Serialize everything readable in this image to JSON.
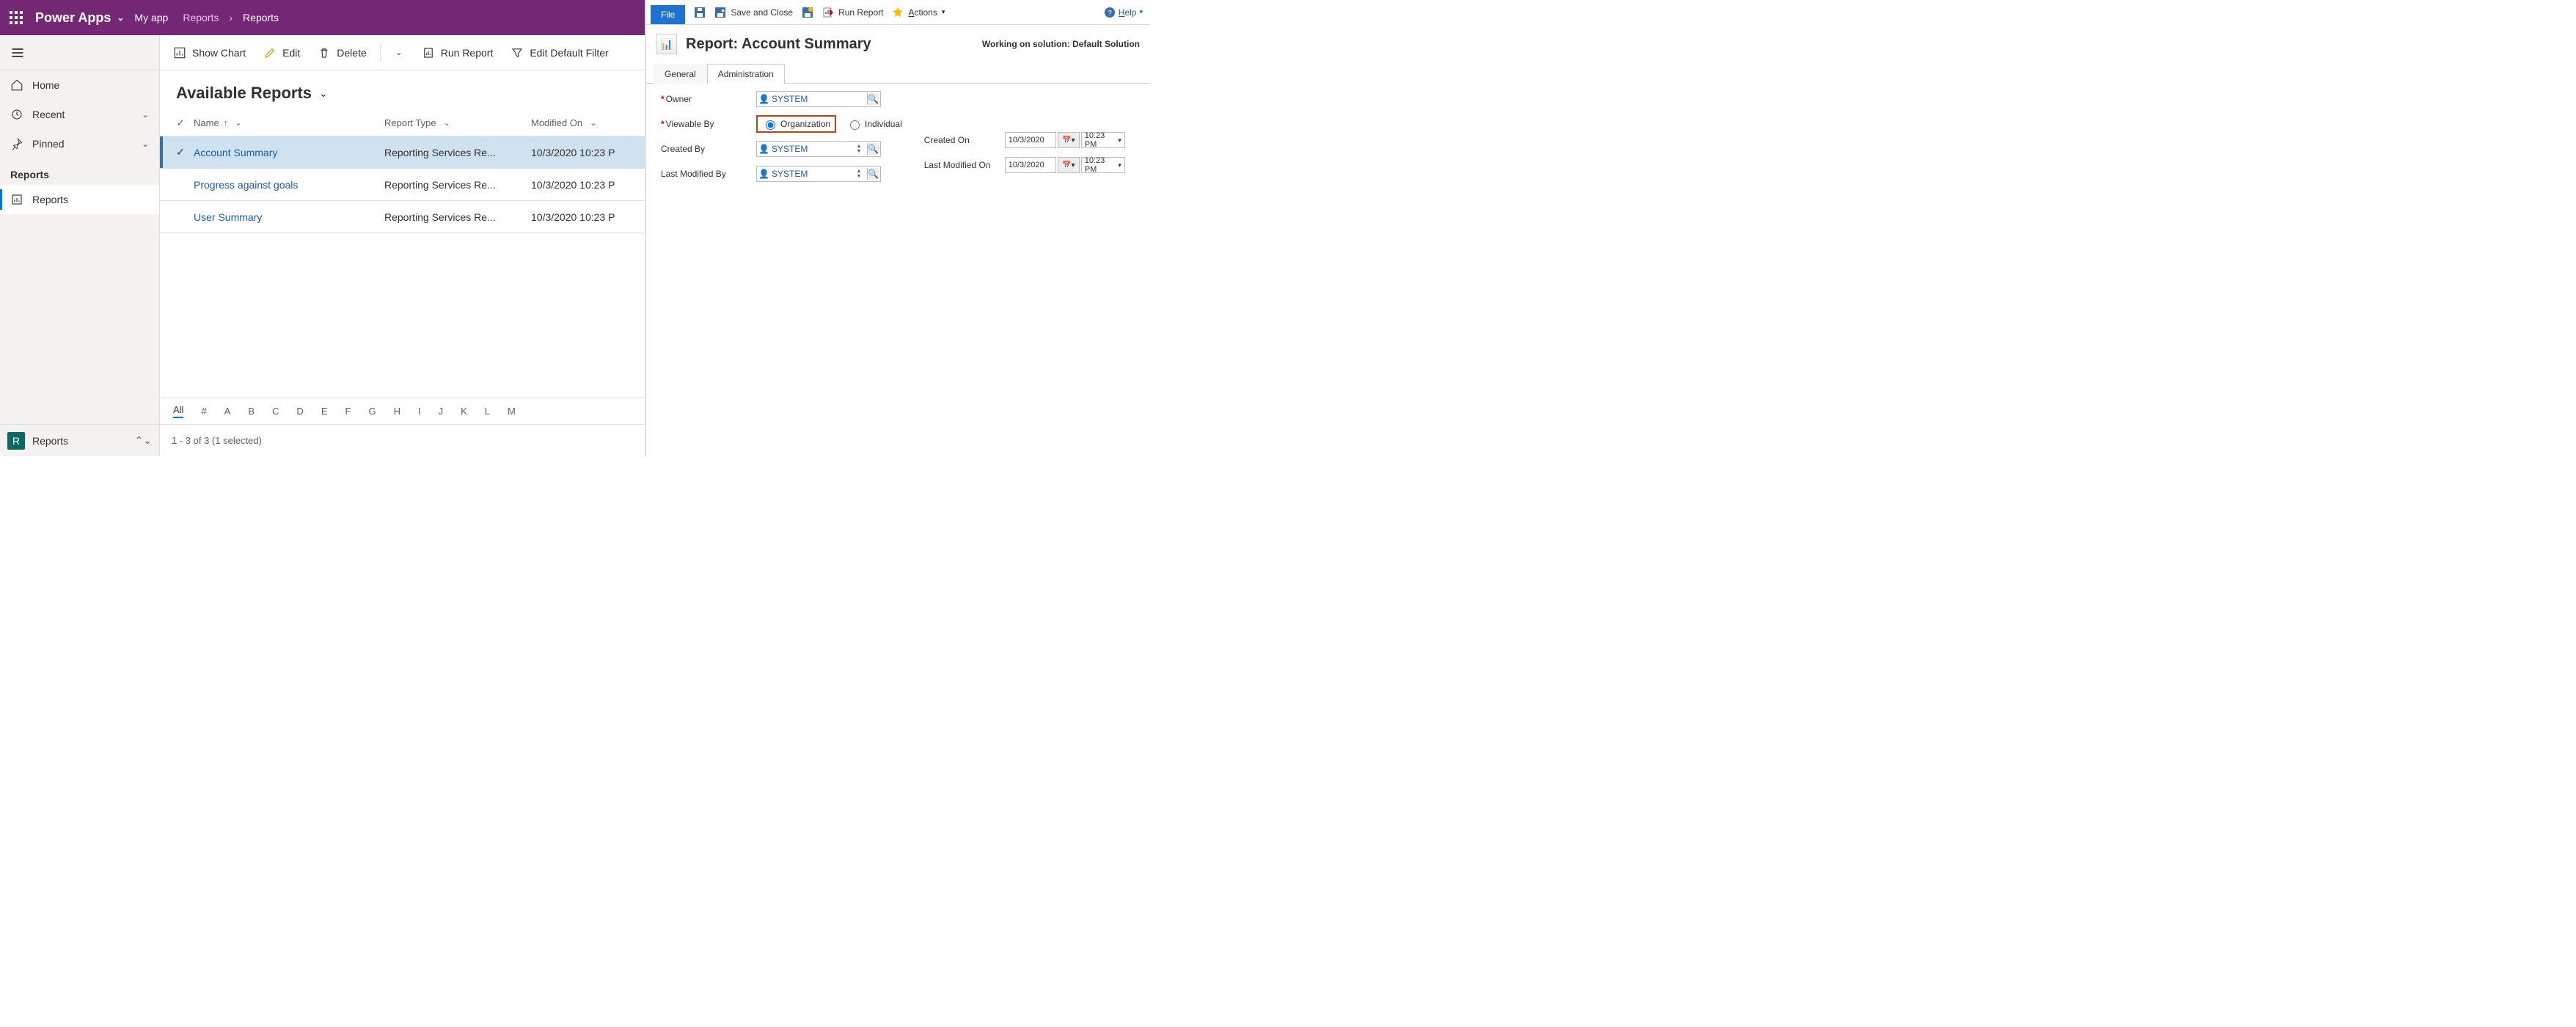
{
  "topbar": {
    "app": "Power Apps",
    "myapp": "My app",
    "crumb1": "Reports",
    "crumb_sep": "›",
    "crumb2": "Reports"
  },
  "sidebar": {
    "home": "Home",
    "recent": "Recent",
    "pinned": "Pinned",
    "section": "Reports",
    "reports": "Reports",
    "footer_badge": "R",
    "footer_label": "Reports"
  },
  "toolbar": {
    "show_chart": "Show Chart",
    "edit": "Edit",
    "delete": "Delete",
    "run_report": "Run Report",
    "edit_filter": "Edit Default Filter"
  },
  "list": {
    "title": "Available Reports",
    "cols": {
      "name": "Name",
      "type": "Report Type",
      "modified": "Modified On"
    },
    "rows": [
      {
        "name": "Account Summary",
        "type": "Reporting Services Re...",
        "modified": "10/3/2020 10:23 P",
        "selected": true
      },
      {
        "name": "Progress against goals",
        "type": "Reporting Services Re...",
        "modified": "10/3/2020 10:23 P",
        "selected": false
      },
      {
        "name": "User Summary",
        "type": "Reporting Services Re...",
        "modified": "10/3/2020 10:23 P",
        "selected": false
      }
    ],
    "alpha": [
      "All",
      "#",
      "A",
      "B",
      "C",
      "D",
      "E",
      "F",
      "G",
      "H",
      "I",
      "J",
      "K",
      "L",
      "M"
    ],
    "footer": "1 - 3 of 3 (1 selected)"
  },
  "right": {
    "file": "File",
    "save_close": "Save and Close",
    "run_report": "Run Report",
    "actions": "Actions",
    "help": "Help",
    "title": "Report: Account Summary",
    "solution": "Working on solution: Default Solution",
    "tabs": {
      "general": "General",
      "admin": "Administration"
    },
    "form": {
      "owner_label": "Owner",
      "owner_value": "SYSTEM",
      "viewable_label": "Viewable By",
      "viewable_org": "Organization",
      "viewable_ind": "Individual",
      "created_by_label": "Created By",
      "created_by_value": "SYSTEM",
      "modified_by_label": "Last Modified By",
      "modified_by_value": "SYSTEM",
      "created_on_label": "Created On",
      "created_on_date": "10/3/2020",
      "created_on_time": "10:23 PM",
      "modified_on_label": "Last Modified On",
      "modified_on_date": "10/3/2020",
      "modified_on_time": "10:23 PM"
    }
  }
}
